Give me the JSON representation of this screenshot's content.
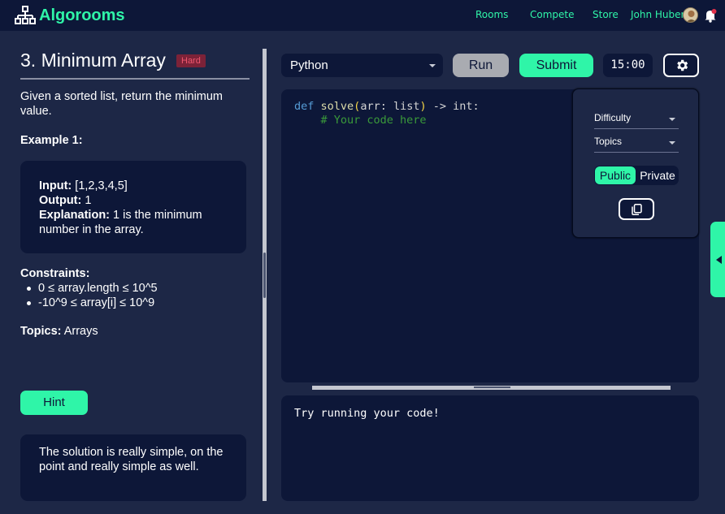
{
  "colors": {
    "accent": "#2ff5a8",
    "background": "#1d2746",
    "panel": "#0d1738",
    "hard_badge_bg": "#7c2238",
    "hard_badge_text": "#f0576f",
    "notification_dot": "#e0314a"
  },
  "nav": {
    "brand": "Algorooms",
    "links": [
      "Rooms",
      "Compete",
      "Store"
    ],
    "username": "John Huber",
    "icons": [
      "sitemap-logo-icon",
      "avatar",
      "bell-icon"
    ]
  },
  "problem": {
    "title": "3. Minimum Array",
    "difficulty": "Hard",
    "description": "Given a sorted list, return the minimum value.",
    "example_heading": "Example 1:",
    "example": {
      "input_label": "Input:",
      "input_value": " [1,2,3,4,5]",
      "output_label": "Output:",
      "output_value": " 1",
      "explanation_label": "Explanation:",
      "explanation_value": " 1 is the minimum number in the array."
    },
    "constraints_heading": "Constraints:",
    "constraints": [
      "0 ≤ array.length ≤ 10^5",
      "-10^9 ≤ array[i] ≤ 10^9"
    ],
    "topics_label": "Topics:",
    "topics_value": " Arrays",
    "hint_button": "Hint",
    "hint_text": "The solution is really simple, on the point and really simple as well."
  },
  "toolbar": {
    "language": "Python",
    "run_label": "Run",
    "submit_label": "Submit",
    "timer": "15:00"
  },
  "editor": {
    "line1": {
      "kw": "def",
      "fn": "solve",
      "open": "(",
      "params": "arr: list",
      "close": ")",
      "ret": " -> int:"
    },
    "line2_comment": "# Your code here"
  },
  "settings_popup": {
    "difficulty_label": "Difficulty",
    "topics_label": "Topics",
    "visibility_options": [
      "Public",
      "Private"
    ],
    "visibility_selected": "Public"
  },
  "output": {
    "text": "Try running your code!"
  }
}
